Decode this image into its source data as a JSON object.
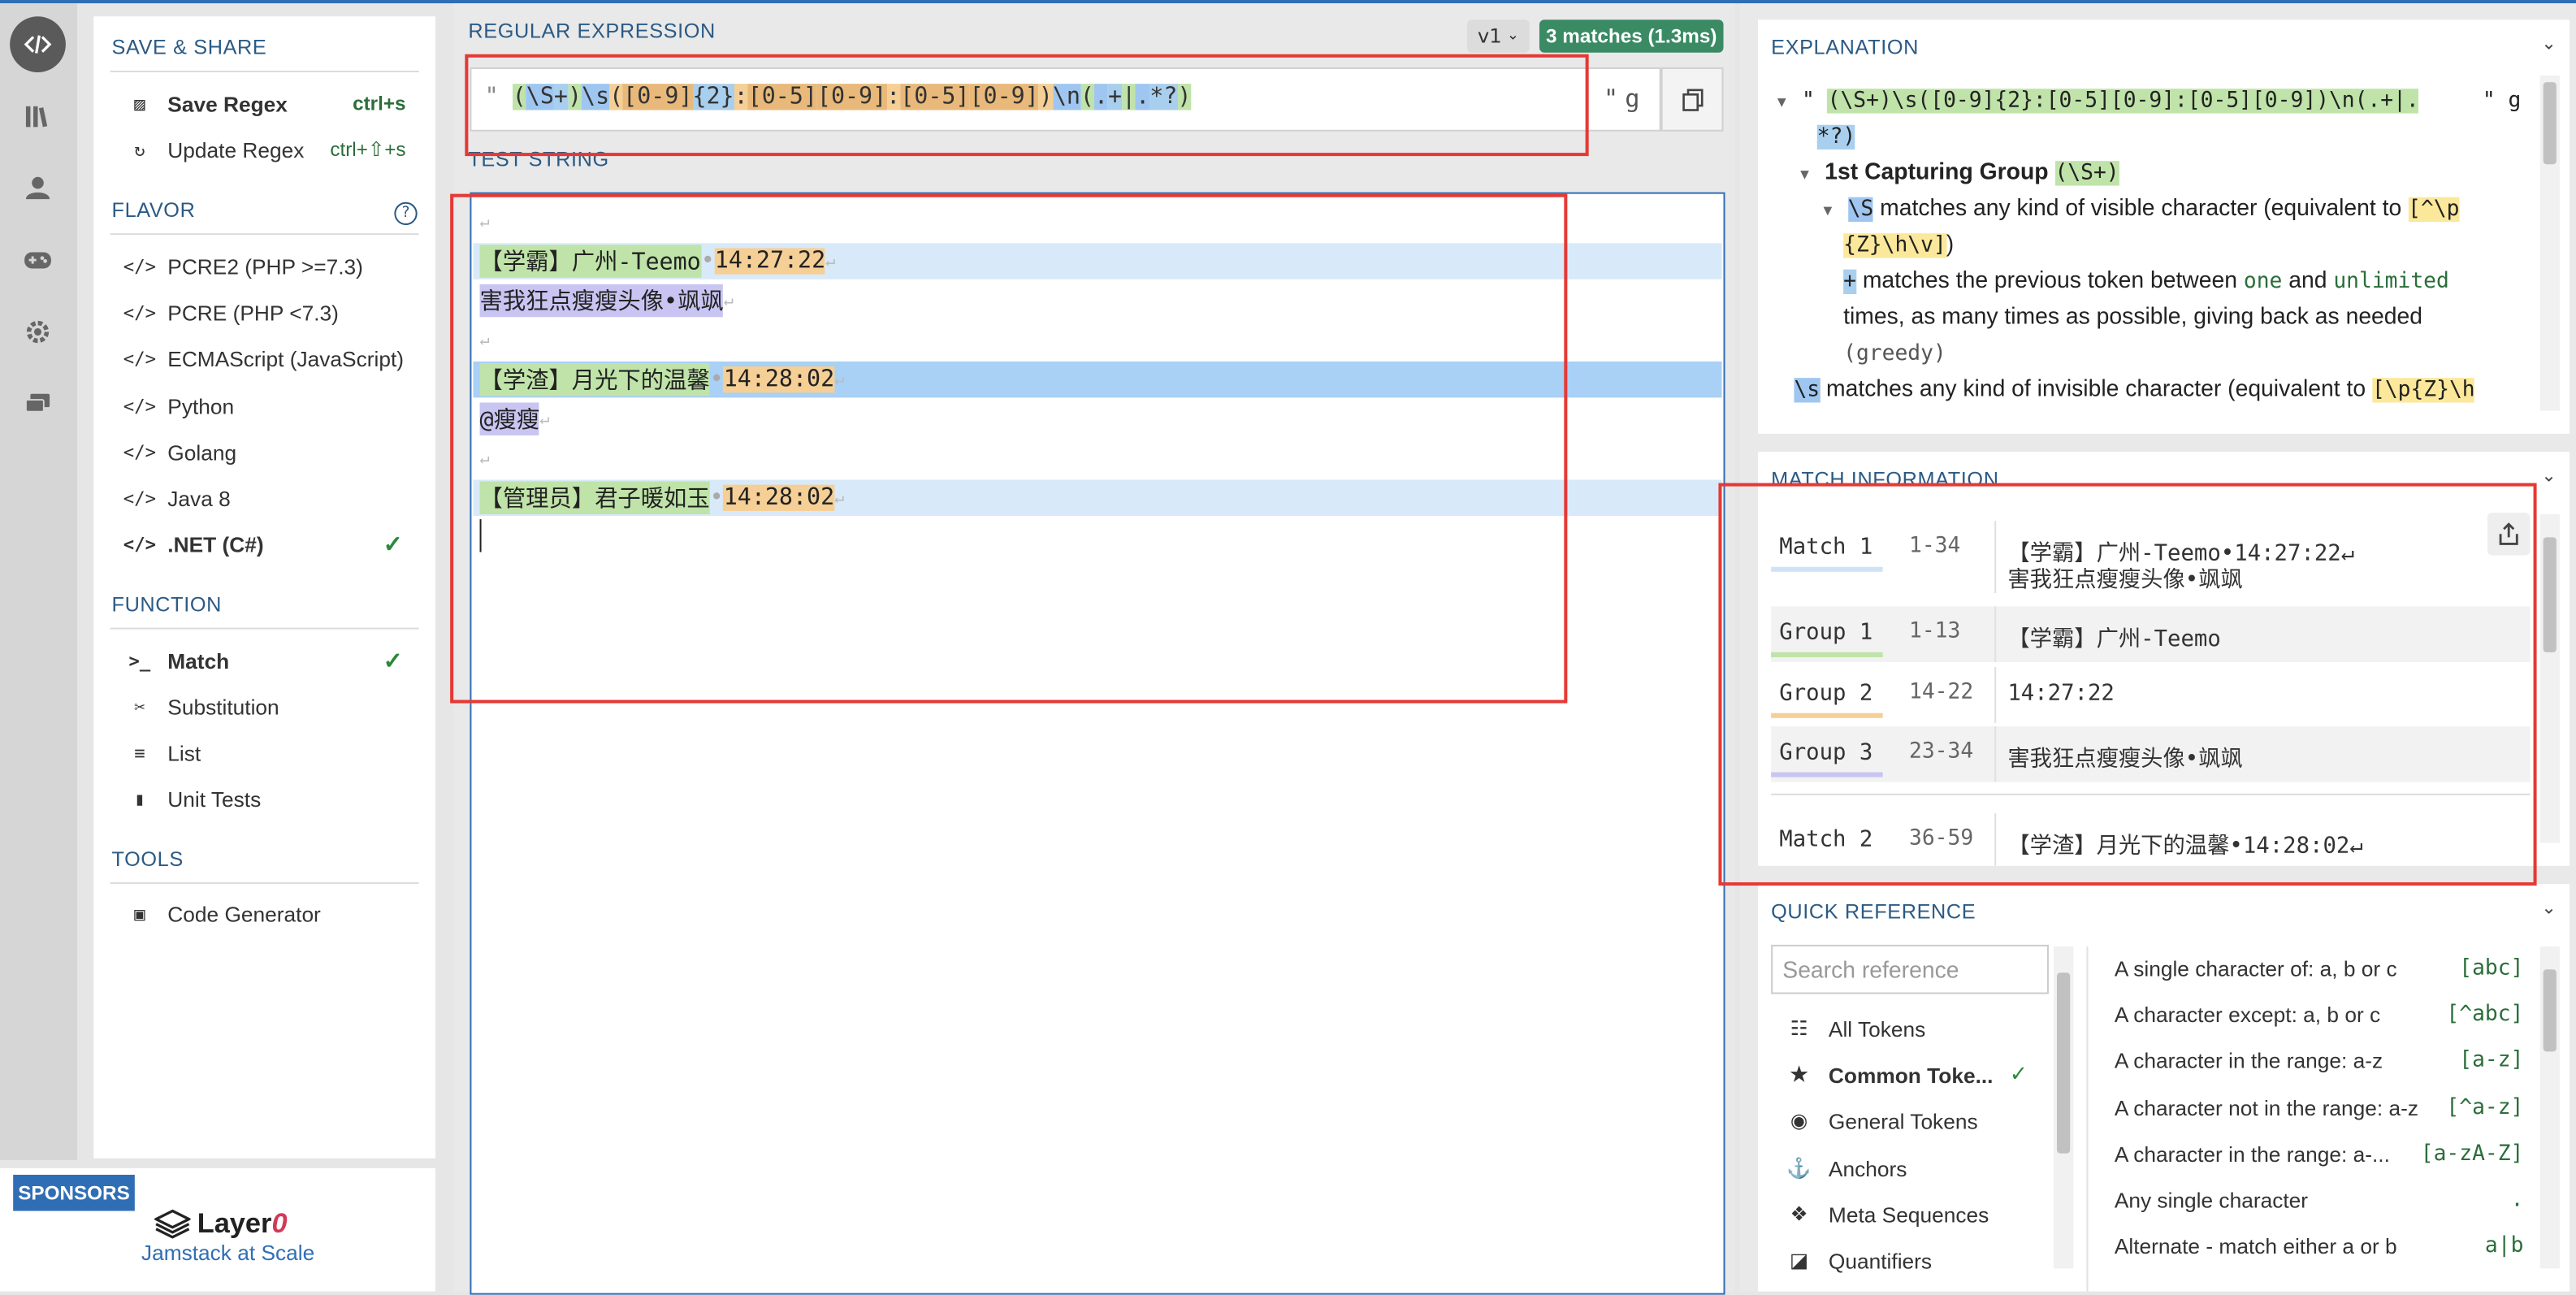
{
  "sidebar": {
    "save_share_title": "SAVE & SHARE",
    "save_label": "Save Regex",
    "save_shortcut": "ctrl+s",
    "update_label": "Update Regex",
    "update_shortcut": "ctrl+⇧+s",
    "flavor_title": "FLAVOR",
    "flavors": [
      "PCRE2 (PHP >=7.3)",
      "PCRE (PHP <7.3)",
      "ECMAScript (JavaScript)",
      "Python",
      "Golang",
      "Java 8",
      ".NET (C#)"
    ],
    "selected_flavor": ".NET (C#)",
    "function_title": "FUNCTION",
    "functions": [
      "Match",
      "Substitution",
      "List",
      "Unit Tests"
    ],
    "selected_function": "Match",
    "tools_title": "TOOLS",
    "tools": [
      "Code Generator"
    ]
  },
  "sponsors": {
    "badge": "SPONSORS",
    "logo_text": "Layer",
    "logo_mark": "0",
    "tagline": "Jamstack at Scale"
  },
  "regex": {
    "title": "REGULAR EXPRESSION",
    "version": "v1",
    "matches_badge": "3 matches (1.3ms)",
    "open_delim": "\"",
    "pattern": "(\\S+)\\s([0-9]{2}:[0-5][0-9]:[0-5][0-9])\\n(.+|.*?)",
    "close_delim": "\"",
    "flags": "g"
  },
  "test_string": {
    "title": "TEST STRING",
    "line1_g1": "【学霸】广州-Teemo",
    "line1_g2": "14:27:22",
    "line2_g3": "害我狂点瘦瘦头像•飒飒",
    "line4_g1": "【学渣】月光下的温馨",
    "line4_g2": "14:28:02",
    "line5_g3": "@瘦瘦",
    "line7_g1": "【管理员】君子暖如玉",
    "line7_g2": "14:28:02"
  },
  "explanation": {
    "title": "EXPLANATION",
    "regex_line_a": "(\\S+)\\s([0-9]{2}:[0-5][0-9]:[0-5][0-9])\\n(.+|.",
    "regex_line_b": "*?)",
    "flags": "g",
    "group1_title": "1st Capturing Group",
    "group1_token": "(\\S+)",
    "s_token": "\\S",
    "s_desc": " matches any kind of visible character (equivalent to ",
    "s_equiv_a": "[^\\p",
    "s_equiv_b": "{Z}\\h\\v]",
    "s_close": ")",
    "plus_token": "+",
    "plus_desc_a": " matches the previous token between ",
    "plus_one": "one",
    "plus_and": " and ",
    "plus_unlimited": "unlimited",
    "plus_desc_b": "times, as many times as possible, giving back as needed",
    "plus_greedy": "(greedy)",
    "ws_token": "\\s",
    "ws_desc": " matches any kind of invisible character (equivalent to ",
    "ws_equiv": "[\\p{Z}\\h"
  },
  "match_info": {
    "title": "MATCH INFORMATION",
    "rows": [
      {
        "label": "Match 1",
        "range": "1-34",
        "value": "【学霸】广州-Teemo•14:27:22↵",
        "value2": "害我狂点瘦瘦头像•飒飒"
      },
      {
        "label": "Group 1",
        "range": "1-13",
        "value": "【学霸】广州-Teemo"
      },
      {
        "label": "Group 2",
        "range": "14-22",
        "value": "14:27:22"
      },
      {
        "label": "Group 3",
        "range": "23-34",
        "value": "害我狂点瘦瘦头像•飒飒"
      },
      {
        "label": "Match 2",
        "range": "36-59",
        "value": "【学渣】月光下的温馨•14:28:02↵"
      }
    ]
  },
  "quick_ref": {
    "title": "QUICK REFERENCE",
    "search_placeholder": "Search reference",
    "categories": [
      "All Tokens",
      "Common Toke...",
      "General Tokens",
      "Anchors",
      "Meta Sequences",
      "Quantifiers"
    ],
    "selected_category": "Common Toke...",
    "refs": [
      {
        "desc": "A single character of: a, b or c",
        "token": "[abc]"
      },
      {
        "desc": "A character except: a, b or c",
        "token": "[^abc]"
      },
      {
        "desc": "A character in the range: a-z",
        "token": "[a-z]"
      },
      {
        "desc": "A character not in the range: a-z",
        "token": "[^a-z]"
      },
      {
        "desc": "A character in the range: a-...",
        "token": "[a-zA-Z]"
      },
      {
        "desc": "Any single character",
        "token": "."
      },
      {
        "desc": "Alternate - match either a or b",
        "token": "a|b"
      }
    ]
  },
  "colors": {
    "accent": "#2f6eb5",
    "badge_green": "#3a8a64",
    "annotation_red": "#e53935",
    "group1": "#bfe3a8",
    "group2": "#f5cf95",
    "group3": "#c9c5f2"
  }
}
